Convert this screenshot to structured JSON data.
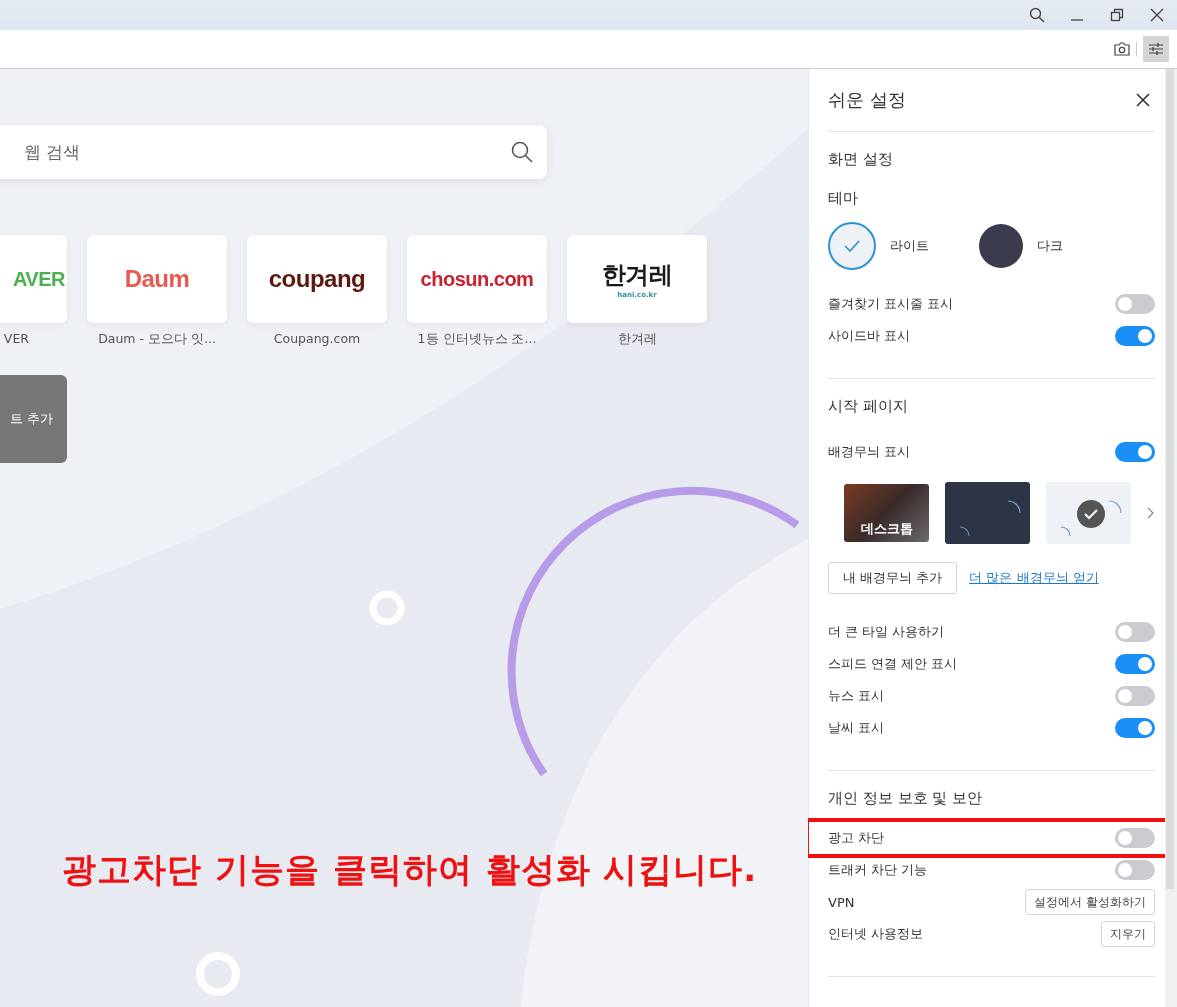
{
  "search": {
    "placeholder": "웹 검색"
  },
  "tiles": [
    {
      "logo": "AVER",
      "color": "#4caf50",
      "label": "VER"
    },
    {
      "logo": "Daum",
      "color": "#e8594f",
      "label": "Daum - 모으다 잇..."
    },
    {
      "logo": "coupang",
      "color": "#5a1a12",
      "label": "Coupang.com"
    },
    {
      "logo": "chosun.com",
      "color": "#c8202f",
      "label": "1등 인터넷뉴스 조..."
    },
    {
      "logo": "한겨레",
      "color": "#1a1a1a",
      "sublogo": "hani.co.kr",
      "label": "한겨레"
    }
  ],
  "add_tile": {
    "label": "트 추가"
  },
  "annotation": {
    "text": "광고차단 기능을 클릭하여 활성화 시킵니다."
  },
  "panel": {
    "title": "쉬운 설정",
    "sections": [
      {
        "heading": "화면 설정",
        "subheading": "테마",
        "themes": [
          {
            "label": "라이트",
            "color": "#eef1f6",
            "selected": true
          },
          {
            "label": "다크",
            "color": "#3a3c4e",
            "selected": false
          }
        ],
        "rows": [
          {
            "kind": "toggle",
            "label": "즐겨찾기 표시줄 표시",
            "on": false
          },
          {
            "kind": "toggle",
            "label": "사이드바 표시",
            "on": true
          }
        ]
      },
      {
        "heading": "시작 페이지",
        "rows": [
          {
            "kind": "toggle",
            "label": "배경무늬 표시",
            "on": true
          }
        ],
        "wallpapers": [
          {
            "kind": "photo",
            "label": "데스크톱",
            "selected": false
          },
          {
            "kind": "dark",
            "selected": false
          },
          {
            "kind": "light",
            "selected": true
          }
        ],
        "wallpaper_actions": {
          "button": "내 배경무늬 추가",
          "link": "더 많은 배경무늬 얻기"
        },
        "rows2": [
          {
            "kind": "toggle",
            "label": "더 큰 타일 사용하기",
            "on": false
          },
          {
            "kind": "toggle",
            "label": "스피드 연결 제안 표시",
            "on": true
          },
          {
            "kind": "toggle",
            "label": "뉴스 표시",
            "on": false
          },
          {
            "kind": "toggle",
            "label": "날씨 표시",
            "on": true
          }
        ]
      },
      {
        "heading": "개인 정보 보호 및 보안",
        "rows": [
          {
            "kind": "toggle",
            "label": "광고 차단",
            "on": false,
            "highlighted": true
          },
          {
            "kind": "toggle",
            "label": "트래커 차단 기능",
            "on": false,
            "highlighted": false
          },
          {
            "kind": "button",
            "label": "VPN",
            "button": "설정에서 활성화하기"
          },
          {
            "kind": "button",
            "label": "인터넷 사용정보",
            "button": "지우기"
          }
        ]
      }
    ]
  }
}
